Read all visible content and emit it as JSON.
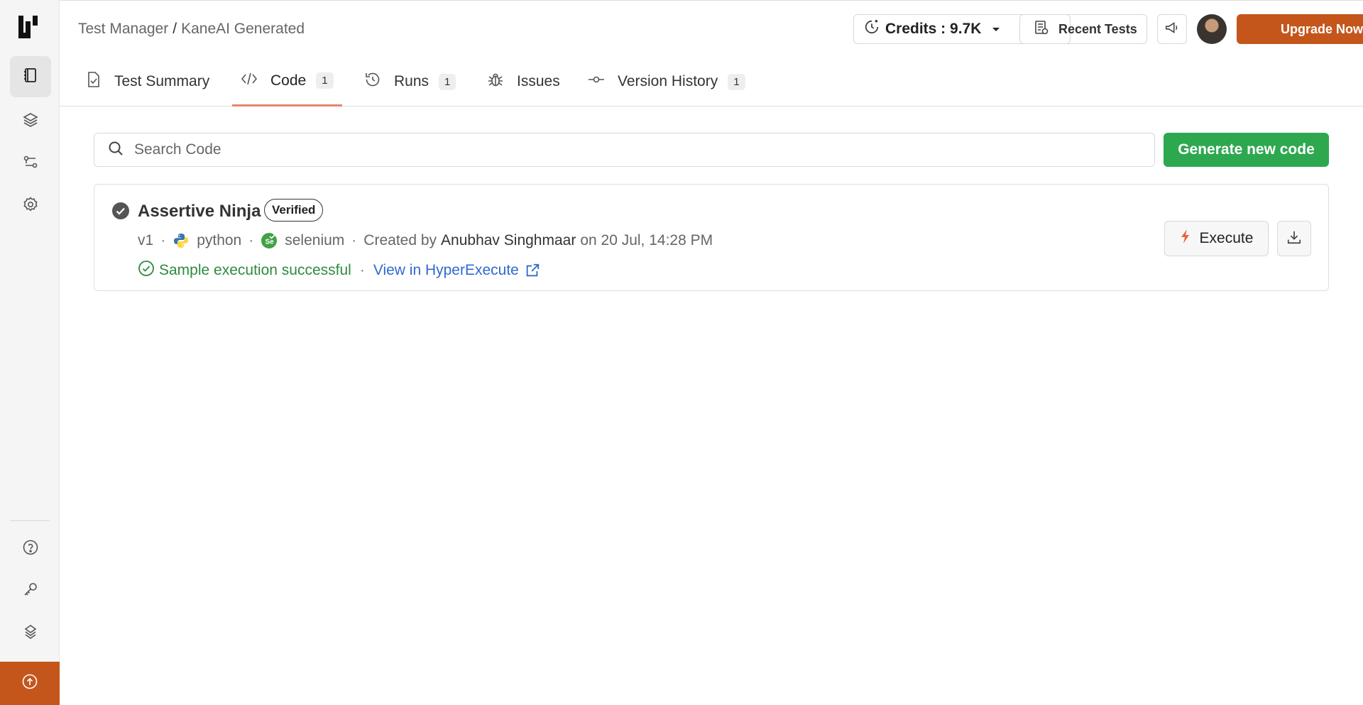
{
  "breadcrumb": {
    "root": "Test Manager",
    "separator": "/",
    "current": "KaneAI Generated"
  },
  "header": {
    "credits_label": "Credits : 9.7K",
    "recent_tests_label": "Recent Tests",
    "upgrade_label": "Upgrade Now"
  },
  "tabs": [
    {
      "label": "Test Summary",
      "count": "",
      "icon": "test-summary-icon",
      "active": false
    },
    {
      "label": "Code",
      "count": "1",
      "icon": "code-icon",
      "active": true
    },
    {
      "label": "Runs",
      "count": "1",
      "icon": "history-icon",
      "active": false
    },
    {
      "label": "Issues",
      "count": "",
      "icon": "bug-icon",
      "active": false
    },
    {
      "label": "Version History",
      "count": "1",
      "icon": "commit-icon",
      "active": false
    }
  ],
  "search": {
    "placeholder": "Search Code",
    "value": ""
  },
  "generate_button_label": "Generate new code",
  "code_card": {
    "title": "Assertive Ninja",
    "badge": "Verified",
    "version": "v1",
    "language": "python",
    "framework": "selenium",
    "created_prefix": "Created by",
    "author": "Anubhav Singhmaar",
    "date": "on 20 Jul, 14:28 PM",
    "status": "Sample execution successful",
    "link": "View in HyperExecute",
    "execute_label": "Execute"
  },
  "sidebar": {
    "items": [
      "test-manager-icon",
      "layers-icon",
      "workflow-icon",
      "settings-icon"
    ],
    "bottom_items": [
      "help-icon",
      "key-icon",
      "integrations-icon"
    ]
  },
  "colors": {
    "accent": "#c4561c",
    "primary_green": "#2ea84f",
    "link_blue": "#2f6ad0",
    "success_green": "#2e8b3e",
    "tab_underline": "#e8846b"
  }
}
